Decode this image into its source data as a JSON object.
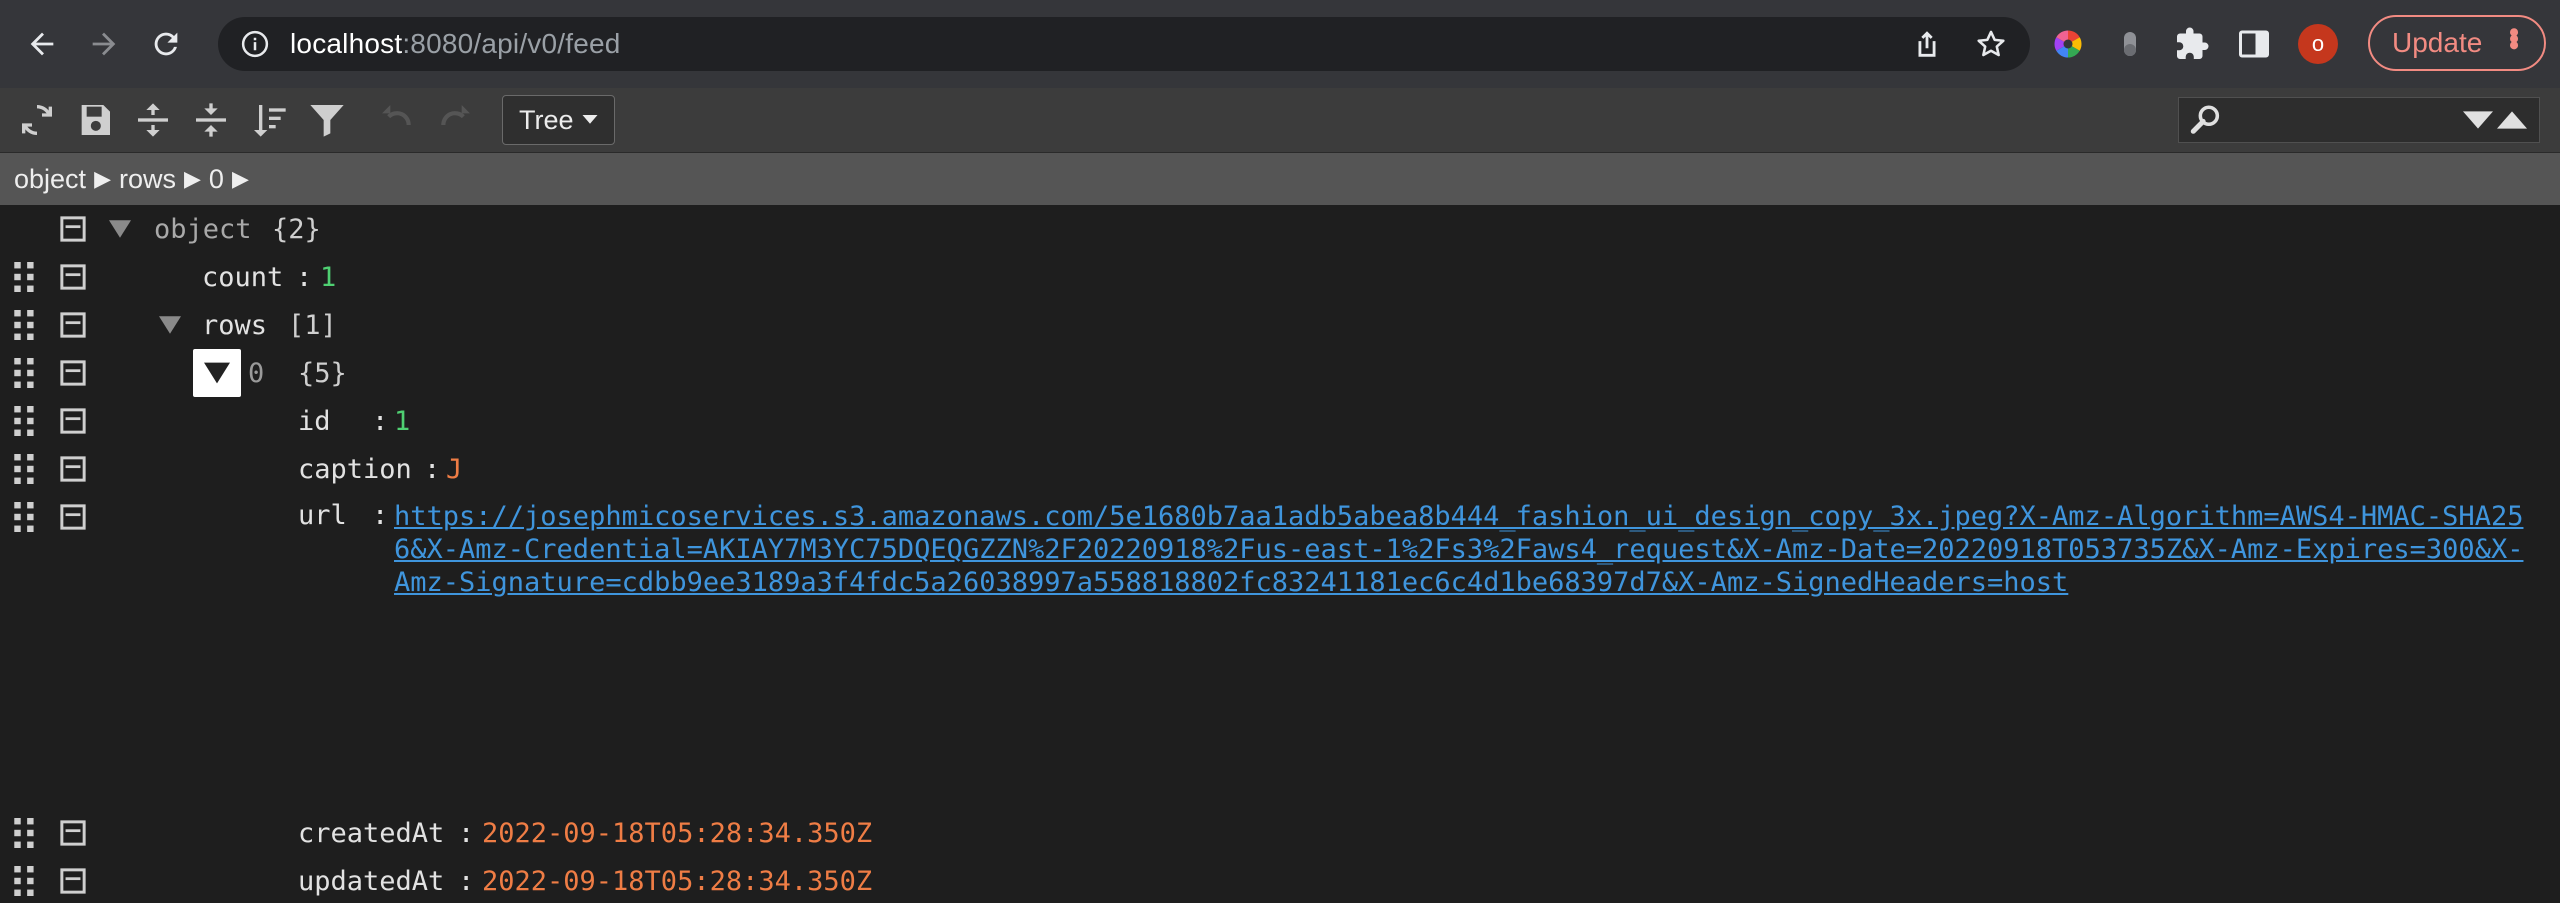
{
  "browser": {
    "url_host": "localhost",
    "url_path": ":8080/api/v0/feed",
    "avatar_letter": "o",
    "update_label": "Update",
    "accent_color": "#f28b82"
  },
  "toolbar": {
    "mode_label": "Tree",
    "search_placeholder": ""
  },
  "breadcrumb": [
    "object",
    "rows",
    "0"
  ],
  "tree": {
    "root": {
      "label": "object",
      "info": "{2}"
    },
    "count": {
      "key": "count",
      "value": "1"
    },
    "rows": {
      "key": "rows",
      "info": "[1]"
    },
    "item0": {
      "index": "0",
      "info": "{5}"
    },
    "id": {
      "key": "id",
      "value": "1"
    },
    "caption": {
      "key": "caption",
      "value": "J"
    },
    "url": {
      "key": "url",
      "value": "https://josephmicoservices.s3.amazonaws.com/5e1680b7aa1adb5abea8b444_fashion_ui_design_copy_3x.jpeg?X-Amz-Algorithm=AWS4-HMAC-SHA256&X-Amz-Credential=AKIAY7M3YC75DQEQGZZN%2F20220918%2Fus-east-1%2Fs3%2Faws4_request&X-Amz-Date=20220918T053735Z&X-Amz-Expires=300&X-Amz-Signature=cdbb9ee3189a3f4fdc5a26038997a558818802fc83241181ec6c4d1be68397d7&X-Amz-SignedHeaders=host"
    },
    "createdAt": {
      "key": "createdAt",
      "value": "2022-09-18T05:28:34.350Z"
    },
    "updatedAt": {
      "key": "updatedAt",
      "value": "2022-09-18T05:28:34.350Z"
    }
  }
}
